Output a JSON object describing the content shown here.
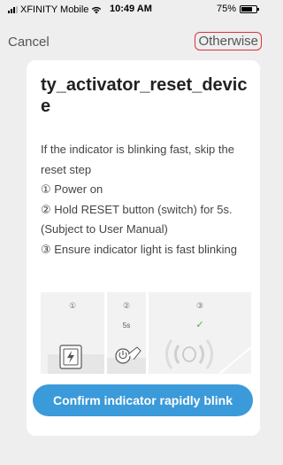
{
  "status_bar": {
    "carrier": "XFINITY Mobile",
    "time": "10:49 AM",
    "battery_text": "75%",
    "battery_level": 0.75
  },
  "nav": {
    "cancel_label": "Cancel",
    "otherwise_label": "Otherwise"
  },
  "card": {
    "title": "ty_activator_reset_device",
    "intro": "If the indicator is blinking fast, skip the reset step",
    "steps": [
      "① Power on",
      "② Hold RESET button (switch) for 5s. (Subject to User Manual)",
      "③ Ensure indicator light is fast blinking"
    ],
    "illustration": {
      "step_labels": [
        "①",
        "②",
        "③"
      ],
      "hold_time": "5s",
      "check_mark": "✓"
    },
    "confirm_label": "Confirm indicator rapidly blink"
  },
  "colors": {
    "background": "#eeeeee",
    "accent": "#3b9ad9",
    "highlight_outline": "#d9323a",
    "check": "#3cb54a"
  },
  "icons": [
    "wifi-icon",
    "battery-icon",
    "signal-icon",
    "power-plug-icon",
    "reset-hand-icon",
    "blinking-light-icon"
  ]
}
